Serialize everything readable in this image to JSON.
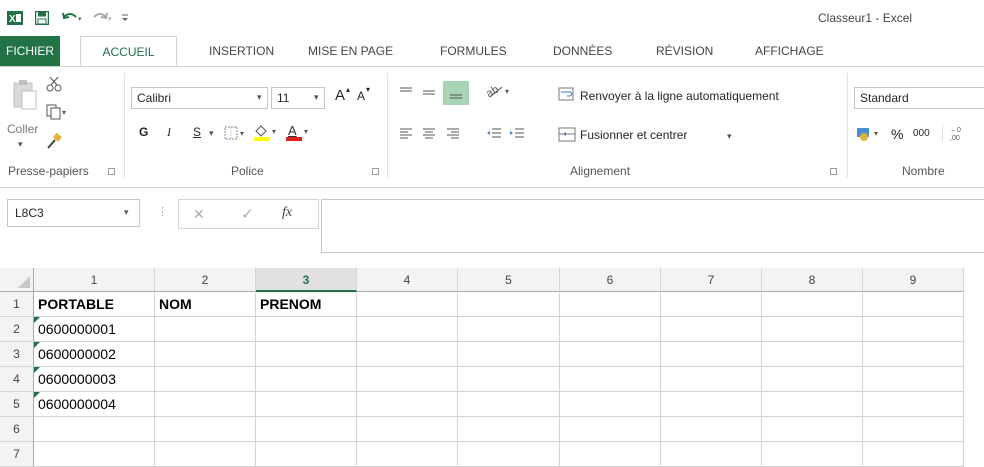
{
  "app": {
    "title": "Classeur1 - Excel"
  },
  "quick_access": {
    "icons": [
      "excel-logo-icon",
      "save-icon",
      "undo-icon",
      "redo-icon",
      "customize-qat-icon"
    ]
  },
  "ribbon_tabs": [
    "FICHIER",
    "ACCUEIL",
    "INSERTION",
    "MISE EN PAGE",
    "FORMULES",
    "DONNÉES",
    "RÉVISION",
    "AFFICHAGE"
  ],
  "clipboard": {
    "paste_label": "Coller",
    "group_label": "Presse-papiers"
  },
  "font": {
    "name": "Calibri",
    "size": "11",
    "bold": "G",
    "italic": "I",
    "underline": "S",
    "grow": "A",
    "shrink": "A",
    "group_label": "Police"
  },
  "alignment": {
    "wrap_label": "Renvoyer à la ligne automatiquement",
    "merge_label": "Fusionner et centrer",
    "group_label": "Alignement"
  },
  "number": {
    "format": "Standard",
    "percent": "%",
    "thousands": "000",
    "group_label": "Nombre"
  },
  "formula_bar": {
    "name_box": "L8C3",
    "fx": "fx",
    "cancel": "✕",
    "enter": "✓",
    "content": ""
  },
  "grid": {
    "columns": [
      "1",
      "2",
      "3",
      "4",
      "5",
      "6",
      "7",
      "8",
      "9"
    ],
    "selected_column": "3",
    "rows": [
      "1",
      "2",
      "3",
      "4",
      "5",
      "6",
      "7"
    ],
    "cells": [
      [
        "PORTABLE",
        "NOM",
        "PRENOM",
        "",
        "",
        "",
        "",
        "",
        ""
      ],
      [
        "0600000001",
        "",
        "",
        "",
        "",
        "",
        "",
        "",
        ""
      ],
      [
        "0600000002",
        "",
        "",
        "",
        "",
        "",
        "",
        "",
        ""
      ],
      [
        "0600000003",
        "",
        "",
        "",
        "",
        "",
        "",
        "",
        ""
      ],
      [
        "0600000004",
        "",
        "",
        "",
        "",
        "",
        "",
        "",
        ""
      ],
      [
        "",
        "",
        "",
        "",
        "",
        "",
        "",
        "",
        ""
      ],
      [
        "",
        "",
        "",
        "",
        "",
        "",
        "",
        "",
        ""
      ]
    ]
  },
  "colors": {
    "excel_green": "#217346",
    "header_bg": "#f3f3f3",
    "grid_line": "#d4d4d4"
  }
}
